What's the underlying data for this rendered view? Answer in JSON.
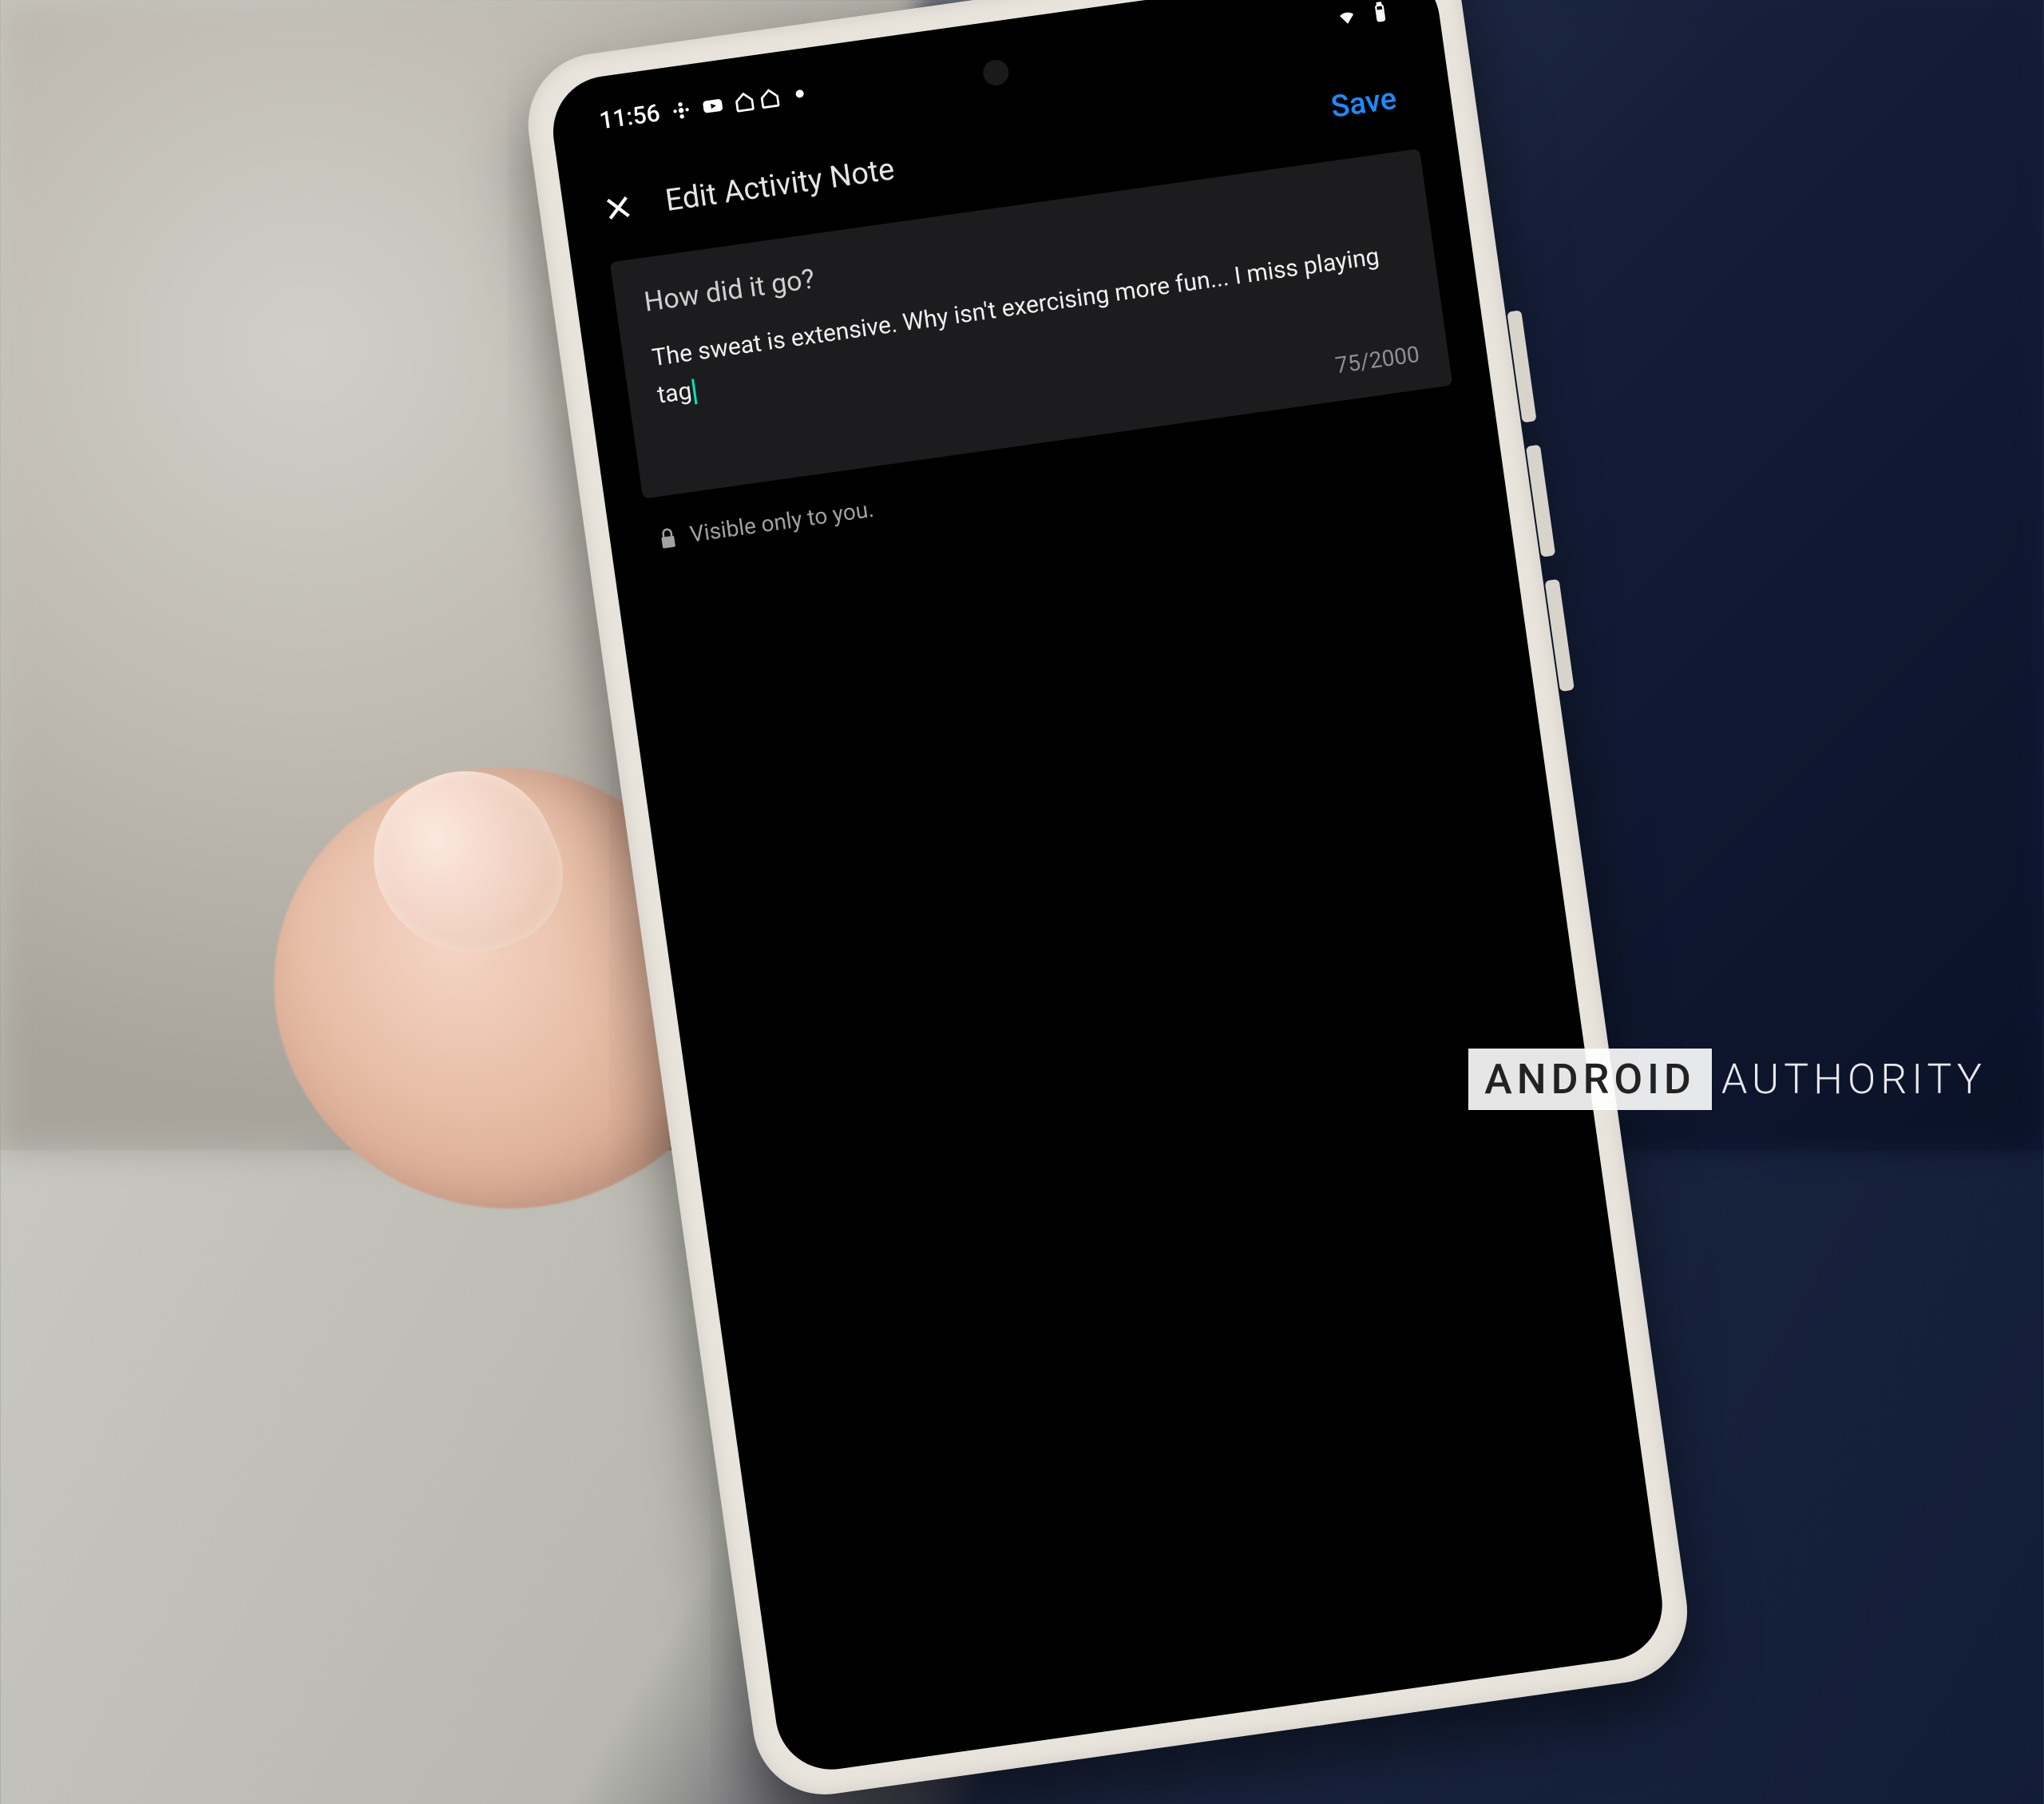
{
  "status_bar": {
    "time": "11:56"
  },
  "header": {
    "title": "Edit Activity Note",
    "save_label": "Save"
  },
  "note": {
    "prompt": "How did it go?",
    "body": "The sweat is extensive. Why isn't exercising more fun... I miss playing tag",
    "char_count": "75/2000"
  },
  "visibility": {
    "label": "Visible only to you."
  },
  "watermark": {
    "brand": "ANDROID",
    "suffix": "AUTHORITY"
  }
}
